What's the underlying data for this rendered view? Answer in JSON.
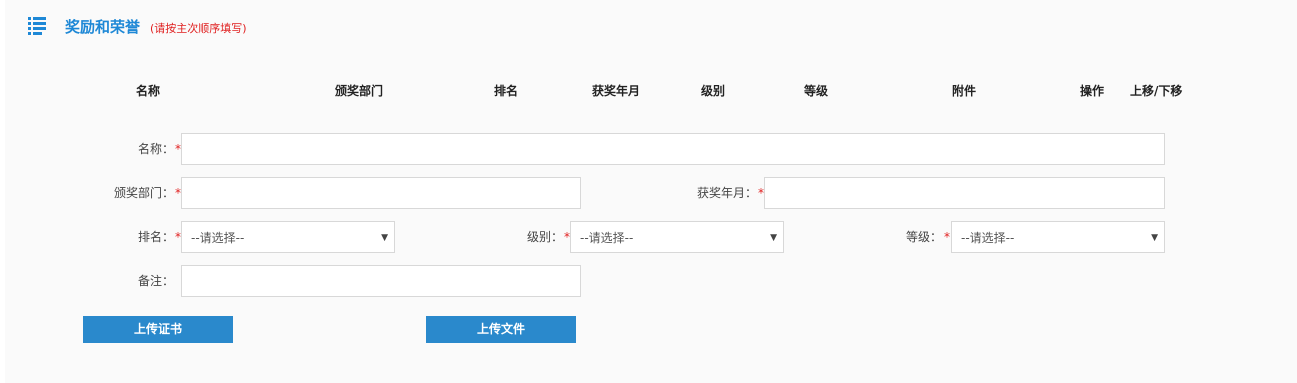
{
  "header": {
    "icon": "list-icon",
    "title": "奖励和荣誉",
    "hint": "(请按主次顺序填写)",
    "accent_color": "#1e88d6",
    "hint_color": "#e02020"
  },
  "table": {
    "columns": [
      "名称",
      "颁奖部门",
      "排名",
      "获奖年月",
      "级别",
      "等级",
      "附件",
      "操作",
      "上移/下移"
    ]
  },
  "form": {
    "required_mark": "*",
    "name": {
      "label": "名称：",
      "value": "",
      "placeholder": ""
    },
    "dept": {
      "label": "颁奖部门：",
      "value": "",
      "placeholder": ""
    },
    "date": {
      "label": "获奖年月：",
      "value": "",
      "placeholder": ""
    },
    "rank": {
      "label": "排名：",
      "selected": "--请选择--"
    },
    "level": {
      "label": "级别：",
      "selected": "--请选择--"
    },
    "grade": {
      "label": "等级：",
      "selected": "--请选择--"
    },
    "remark": {
      "label": "备注：",
      "value": "",
      "placeholder": ""
    }
  },
  "buttons": {
    "upload_certificate": "上传证书",
    "upload_file": "上传文件",
    "color": "#2a89cc"
  },
  "icons": {
    "dropdown": "▼"
  }
}
